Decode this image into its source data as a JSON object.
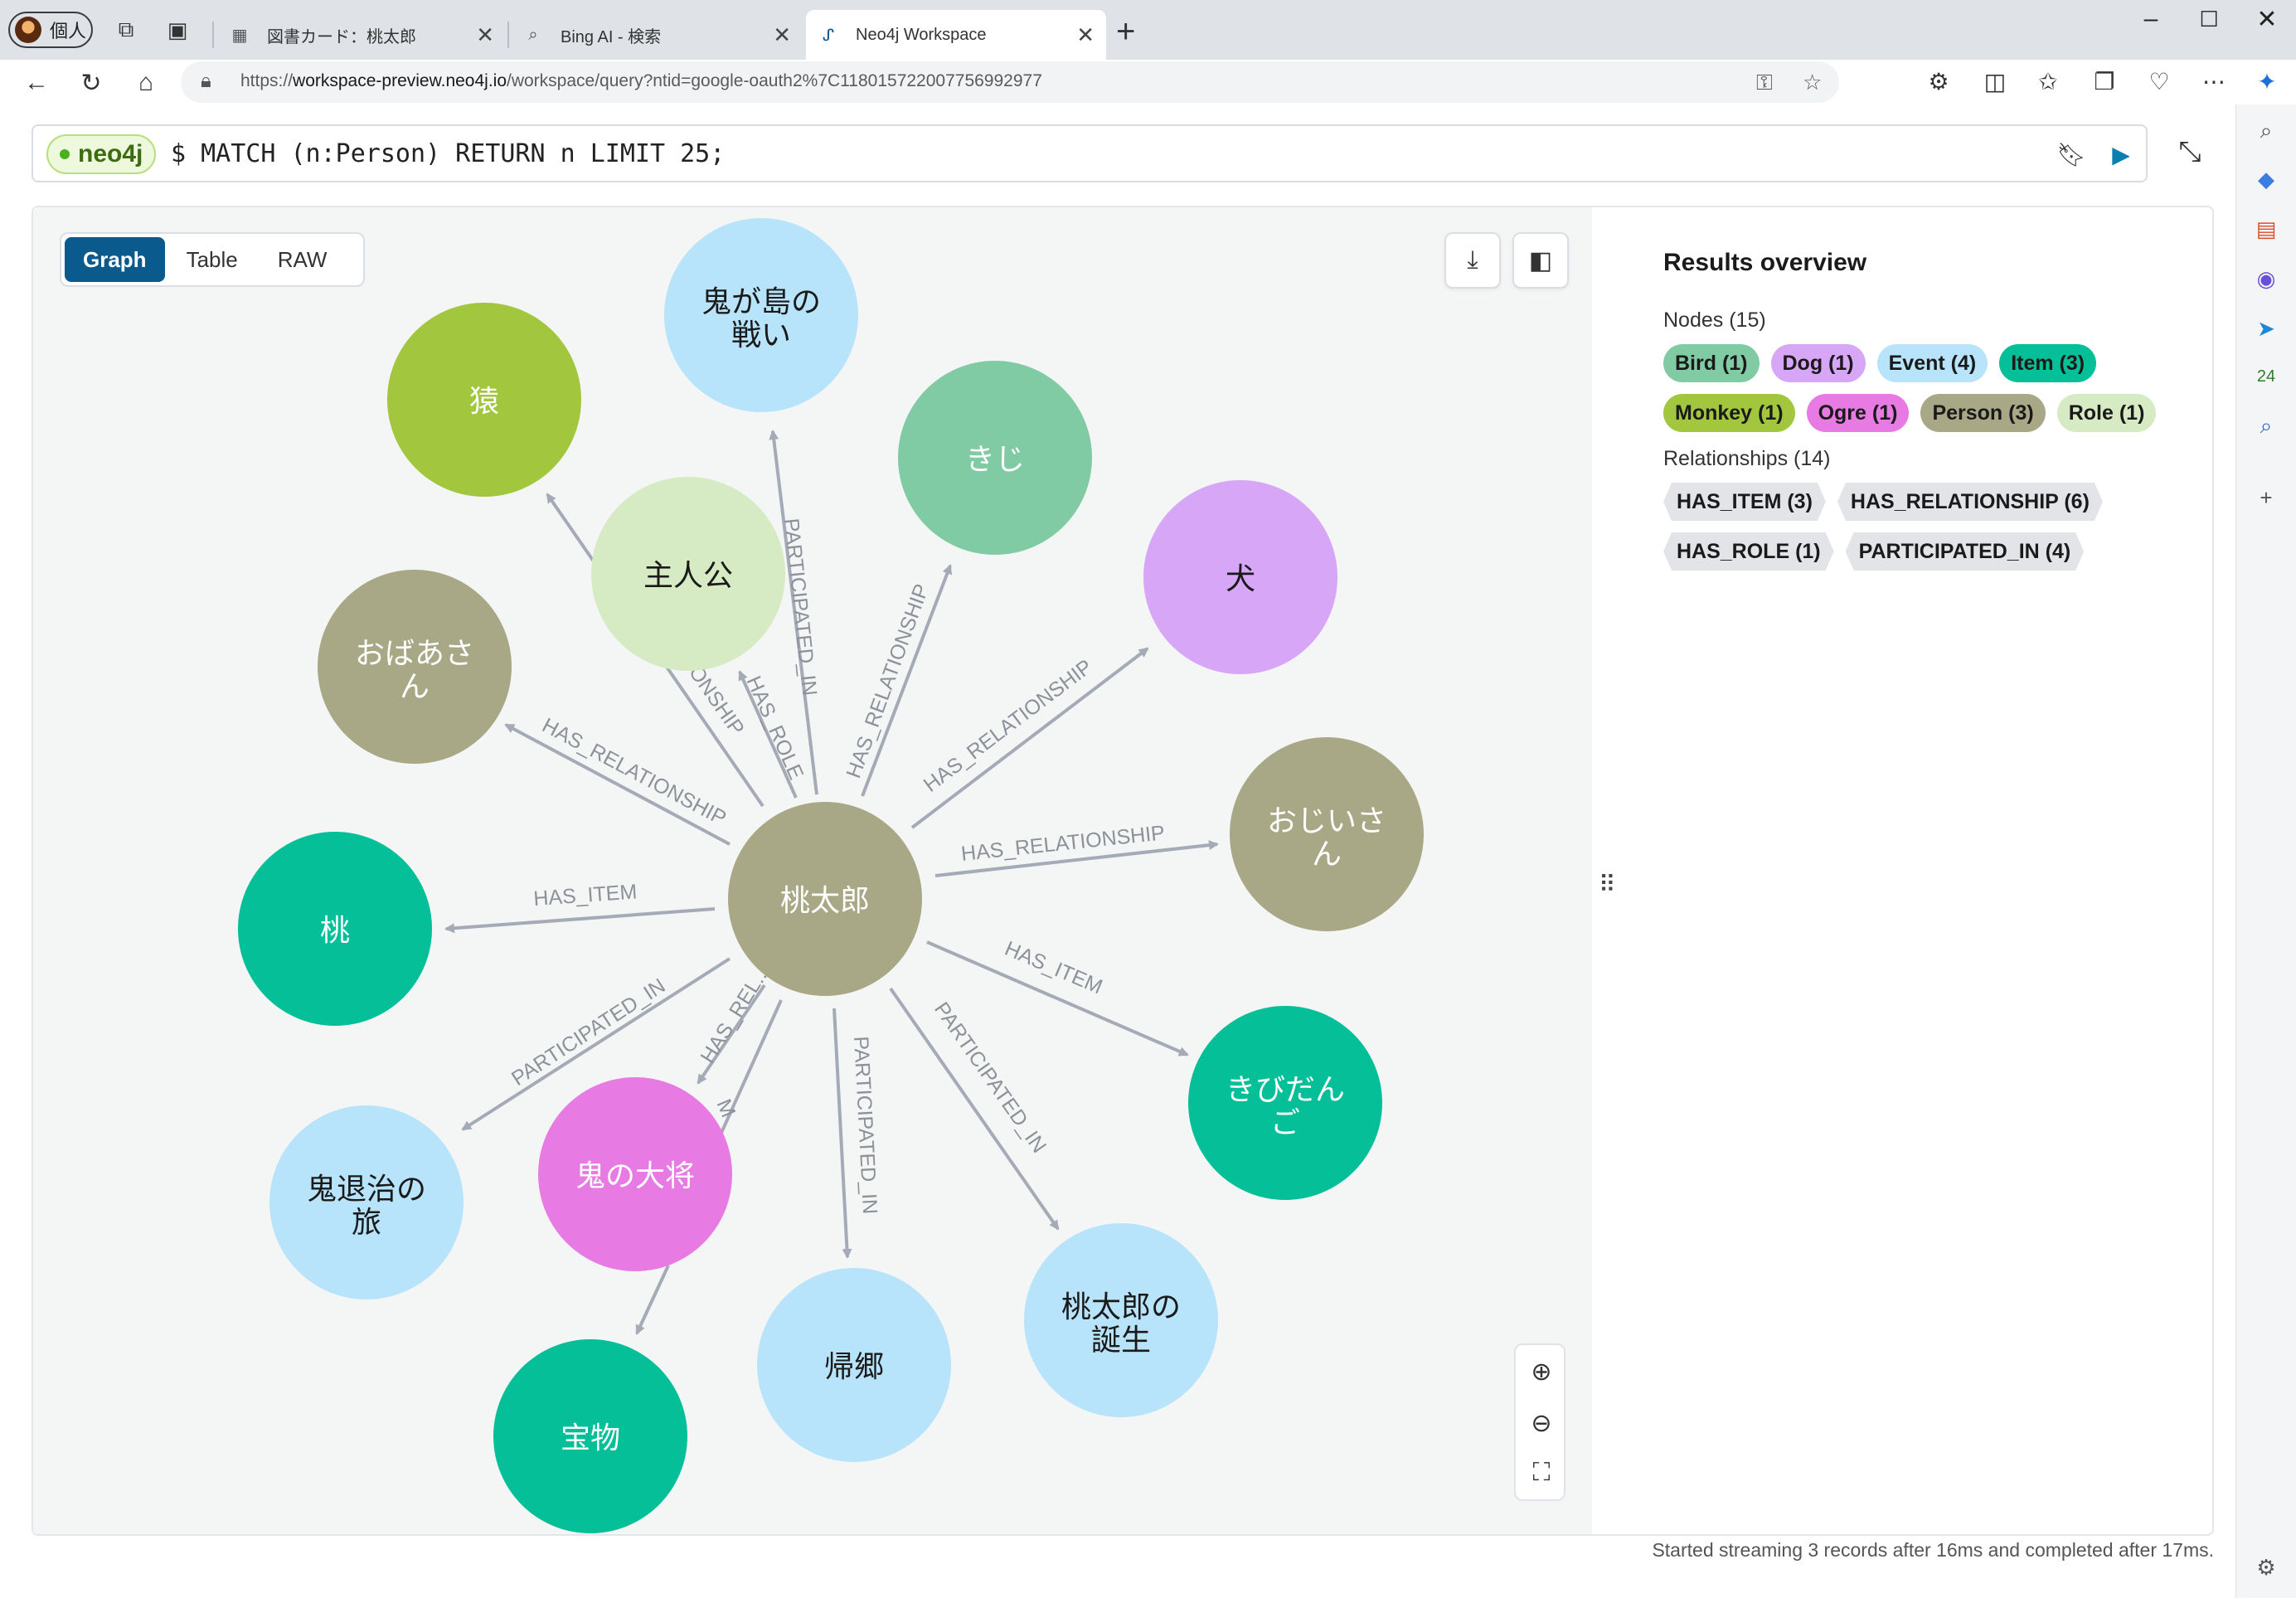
{
  "browser": {
    "profile_label": "個人",
    "tabs": [
      {
        "title": "図書カード：桃太郎",
        "close": "✕"
      },
      {
        "title": "Bing AI - 検索",
        "close": "✕"
      },
      {
        "title": "Neo4j Workspace",
        "close": "✕"
      }
    ],
    "new_tab": "+",
    "url_prefix": "https://",
    "url_host": "workspace-preview.neo4j.io",
    "url_rest": "/workspace/query?ntid=google-oauth2%7C118015722007756992977"
  },
  "query": {
    "db_label": "neo4j",
    "text": "$ MATCH (n:Person) RETURN n LIMIT 25;"
  },
  "view_toggle": {
    "graph": "Graph",
    "table": "Table",
    "raw": "RAW"
  },
  "overview": {
    "title": "Results overview",
    "nodes_label": "Nodes (15)",
    "node_chips": [
      {
        "label": "Bird (1)",
        "color": "#81cba4"
      },
      {
        "label": "Dog (1)",
        "color": "#d7a6f6"
      },
      {
        "label": "Event (4)",
        "color": "#b8e4fb"
      },
      {
        "label": "Item (3)",
        "color": "#05bf98"
      },
      {
        "label": "Monkey (1)",
        "color": "#a2c73e"
      },
      {
        "label": "Ogre (1)",
        "color": "#e77ae3"
      },
      {
        "label": "Person (3)",
        "color": "#a9a886"
      },
      {
        "label": "Role (1)",
        "color": "#d6eac3"
      }
    ],
    "rels_label": "Relationships (14)",
    "rel_chips": [
      {
        "label": "HAS_ITEM (3)"
      },
      {
        "label": "HAS_RELATIONSHIP (6)"
      },
      {
        "label": "HAS_ROLE (1)"
      },
      {
        "label": "PARTICIPATED_IN (4)"
      }
    ]
  },
  "graph": {
    "nodes": {
      "center": {
        "line1": "桃太郎",
        "line2": "",
        "color": "#a9a886",
        "text_color": "#ffffff"
      },
      "onigashima": {
        "line1": "鬼が島の",
        "line2": "戦い",
        "color": "#b8e4fb",
        "text_color": "#1a1a1a"
      },
      "saru": {
        "line1": "猿",
        "line2": "",
        "color": "#a2c73e",
        "text_color": "#ffffff"
      },
      "kiji": {
        "line1": "きじ",
        "line2": "",
        "color": "#81cba4",
        "text_color": "#ffffff"
      },
      "shujinkou": {
        "line1": "主人公",
        "line2": "",
        "color": "#d6eac3",
        "text_color": "#1a1a1a"
      },
      "inu": {
        "line1": "犬",
        "line2": "",
        "color": "#d7a6f6",
        "text_color": "#1a1a1a"
      },
      "obaasan": {
        "line1": "おばあさ",
        "line2": "ん",
        "color": "#a9a886",
        "text_color": "#ffffff"
      },
      "ojiisan": {
        "line1": "おじいさ",
        "line2": "ん",
        "color": "#a9a886",
        "text_color": "#ffffff"
      },
      "momo": {
        "line1": "桃",
        "line2": "",
        "color": "#05bf98",
        "text_color": "#ffffff"
      },
      "kibidango": {
        "line1": "きびだん",
        "line2": "ご",
        "color": "#05bf98",
        "text_color": "#ffffff"
      },
      "onitaiji": {
        "line1": "鬼退治の",
        "line2": "旅",
        "color": "#b8e4fb",
        "text_color": "#1a1a1a"
      },
      "oninotaishou": {
        "line1": "鬼の大将",
        "line2": "",
        "color": "#e77ae3",
        "text_color": "#ffffff"
      },
      "kikyou": {
        "line1": "帰郷",
        "line2": "",
        "color": "#b8e4fb",
        "text_color": "#1a1a1a"
      },
      "tanjou": {
        "line1": "桃太郎の",
        "line2": "誕生",
        "color": "#b8e4fb",
        "text_color": "#1a1a1a"
      },
      "takaramono": {
        "line1": "宝物",
        "line2": "",
        "color": "#05bf98",
        "text_color": "#ffffff"
      }
    },
    "rel_labels": {
      "to_onigashima": "PARTICIPATED_IN",
      "to_kiji": "HAS_RELATIONSHIP",
      "to_inu": "HAS_RELATIONSHIP",
      "to_ojiisan": "HAS_RELATIONSHIP",
      "to_kibidango": "HAS_ITEM",
      "to_tanjou": "PARTICIPATED_IN",
      "to_kikyou": "PARTICIPATED_IN",
      "to_momo": "HAS_ITEM",
      "to_obaasan": "HAS_RELATIONSHIP",
      "to_onitaiji": "PARTICIPATED_IN",
      "to_shujinkou": "HAS_ROLE",
      "to_saru_partial": "ONSHIP",
      "to_ogre_partial": "HAS_REL...",
      "ogre_partial": "M"
    },
    "edge_color": "#a5abb6"
  },
  "status_text": "Started streaming 3 records after 16ms and completed after 17ms."
}
